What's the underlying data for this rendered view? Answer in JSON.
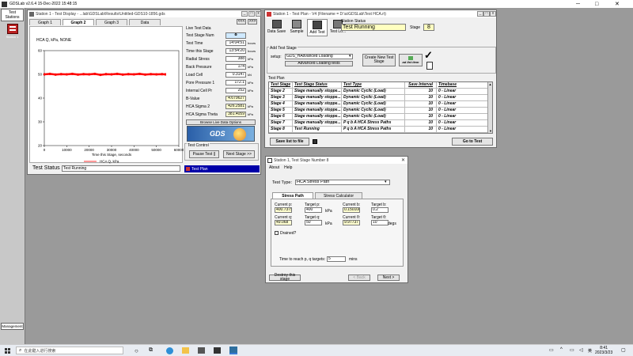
{
  "app": {
    "title": "GDSLab v2.6.4 15-Dec-2022 15:48:15",
    "min_icon": "minimize-icon",
    "max_icon": "maximize-icon",
    "close_icon": "close-icon"
  },
  "sidebar": {
    "header": "Test Stations",
    "station_label": "Station 1",
    "footer": "Management"
  },
  "display_window": {
    "title": "Station 1 - Test Display - ...lab\\GDSLab\\Results\\Untitled-GDS10-1856.gds",
    "tabs": [
      "Graph 1",
      "Graph 2",
      "Graph 3",
      "Data"
    ],
    "active_tab": "Graph 2",
    "nav": [
      "<<<",
      ">>>"
    ],
    "graph": {
      "title": "HCA Q, kPa, NONE",
      "xlabel": "Time this Stage, seconds",
      "legend": "HCA Q, kPa"
    },
    "test_status_label": "Test Status",
    "test_status_value": "Test Running"
  },
  "chart_data": {
    "type": "scatter",
    "title": "HCA Q, kPa, NONE",
    "xlabel": "Time this Stage, seconds",
    "ylabel": "",
    "xlim": [
      0,
      60000
    ],
    "ylim": [
      20,
      60
    ],
    "x_ticks": [
      "0",
      "10000",
      "20000",
      "30000",
      "40000",
      "50000",
      "60000"
    ],
    "y_ticks": [
      "20",
      "30",
      "40",
      "50",
      "60"
    ],
    "series": [
      {
        "name": "HCA Q, kPa",
        "color": "#ff0000",
        "x": [
          0,
          2500,
          5000,
          7500,
          10000,
          12500,
          15000,
          17500,
          20000,
          22500,
          25000,
          27500,
          30000,
          32500,
          35000,
          37500,
          40000,
          42500,
          45000,
          47500,
          50000,
          52500,
          54000
        ],
        "y": [
          50,
          50.2,
          49.9,
          50.1,
          50,
          50.2,
          49.9,
          50.1,
          50,
          50.2,
          49.8,
          50.1,
          50,
          50.2,
          49.9,
          50.1,
          50,
          50.2,
          49.9,
          50.1,
          50,
          50.1,
          50
        ]
      }
    ],
    "grid": false,
    "legend_position": "bottom-center"
  },
  "live": {
    "header": "Live Test Data",
    "rows": [
      {
        "label": "Test Stage Num",
        "value": "8",
        "unit": ""
      },
      {
        "label": "Test Time",
        "value": "14:04:51",
        "unit": "hours"
      },
      {
        "label": "Time this Stage",
        "value": "13:54:20",
        "unit": "hours"
      },
      {
        "label": "Radial Stress",
        "value": "388",
        "unit": "kPa"
      },
      {
        "label": "Back Pressure",
        "value": "174",
        "unit": "kPa"
      },
      {
        "label": "Load Cell",
        "value": "0.3147",
        "unit": "kN"
      },
      {
        "label": "Pore Pressure 1",
        "value": "172.1",
        "unit": "kPa"
      },
      {
        "label": "Internal Cell Pr",
        "value": "252",
        "unit": "kPa"
      },
      {
        "label": "B-Value",
        "value": "4.679627",
        "unit": ""
      },
      {
        "label": "HCA Sigma 2",
        "value": "426.2581",
        "unit": "kPa"
      },
      {
        "label": "HCA Sigma Theta",
        "value": "381.4059",
        "unit": "kPa"
      }
    ],
    "browse_label": "Browse Live Data Options",
    "logo_text": "GDS",
    "test_control_header": "Test Control",
    "pause_btn": "Pause Test ||",
    "next_btn": "Next Stage >>",
    "test_plan_bar": "Test Plan"
  },
  "plan_window": {
    "title": "Station 1 - Test Plan - V4 (Filename = D:\\a\\GDSLab\\Test HCA.rt)",
    "toolbar": [
      "Data Save",
      "Sample",
      "Add Test",
      "Test Lo..."
    ],
    "station_status_label": "Station Status",
    "station_status_value": "Test Running",
    "stage_label": "Stage",
    "stage_value": "8",
    "add_stage_header": "Add Test Stage",
    "setup_label": "setup:",
    "setup_value": "GDS_HAdvanced Loading",
    "advanced_label": "Advanced Loading tests",
    "create_btn": "Create New Test Stage",
    "ad_list_label": "ad list item",
    "test_plan_header": "Test Plan",
    "columns": [
      "Test Stage",
      "Test Stage Status",
      "Test Type",
      "Save Interval",
      "Timebase"
    ],
    "rows": [
      [
        "Stage 2",
        "Stage manually stoppe...",
        "Dynamic Cyclic (Load)",
        "10",
        "0 - Linear"
      ],
      [
        "Stage 3",
        "Stage manually stoppe...",
        "Dynamic Cyclic (Load)",
        "10",
        "0 - Linear"
      ],
      [
        "Stage 4",
        "Stage manually stoppe...",
        "Dynamic Cyclic (Load)",
        "10",
        "0 - Linear"
      ],
      [
        "Stage 5",
        "Stage manually stoppe...",
        "Dynamic Cyclic (Load)",
        "10",
        "0 - Linear"
      ],
      [
        "Stage 6",
        "Stage manually stoppe...",
        "Dynamic Cyclic (Load)",
        "10",
        "0 - Linear"
      ],
      [
        "Stage 7",
        "Stage manually stoppe...",
        "P q b A HCA Stress Paths",
        "10",
        "0 - Linear"
      ],
      [
        "Stage 8",
        "Test Running",
        "P q b A HCA Stress Paths",
        "10",
        "0 - Linear"
      ]
    ],
    "save_list_btn": "Save list to file",
    "go_to_test_btn": "Go to Test"
  },
  "stage_dialog": {
    "title": "Station 1, Test Stage Number 8",
    "menu": [
      "About",
      "Help"
    ],
    "test_type_label": "Test Type:",
    "test_type_value": "HCA Stress Path",
    "tabs": [
      "Stress Path",
      "Stress Calculator"
    ],
    "fields": [
      {
        "label": "Current p:",
        "value": "400.7375"
      },
      {
        "label": "Target p:",
        "value": "400"
      },
      {
        "label": "Current b:",
        "value": "0.150108"
      },
      {
        "label": "Target b:",
        "value": "0.2"
      },
      {
        "label": "Current q:",
        "value": "49.068"
      },
      {
        "label": "Target q:",
        "value": "50"
      },
      {
        "label": "Current θ:",
        "value": "9.977377"
      },
      {
        "label": "Target θ:",
        "value": "10"
      }
    ],
    "unit_kpa": "kPa",
    "unit_degs": "degs",
    "drained_label": "Drained?",
    "time_label": "Time to reach p, q targets:",
    "time_value": "5",
    "time_unit": "mins",
    "destroy_btn": "Destroy this stage",
    "back_btn": "< Back",
    "next_btn": "Next >"
  },
  "taskbar": {
    "search_placeholder": "在此键入进行搜索",
    "lang": "英",
    "time": "8:41",
    "date": "2023/3/23"
  }
}
